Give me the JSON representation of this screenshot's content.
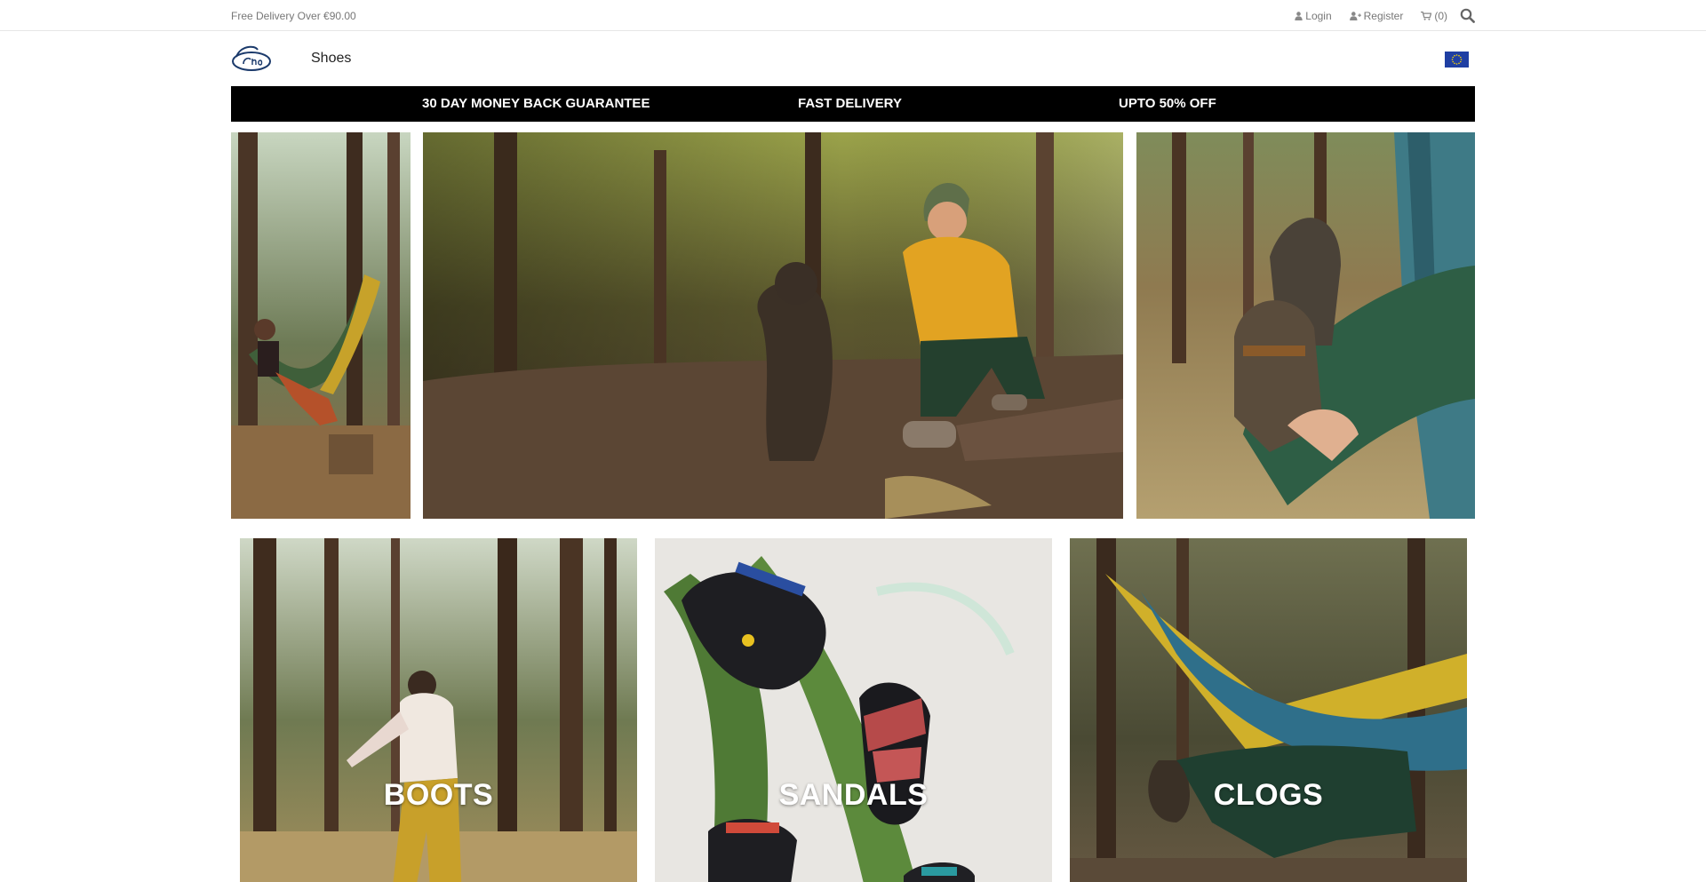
{
  "topbar": {
    "promo": "Free Delivery Over €90.00",
    "login_label": "Login",
    "register_label": "Register",
    "cart_label": "(0)"
  },
  "header": {
    "logo_alt": "Chaco",
    "nav_shoes": "Shoes",
    "region_flag": "eu-flag"
  },
  "usp_bar": {
    "guarantee": "30 DAY MONEY BACK GUARANTEE",
    "delivery": "FAST DELIVERY",
    "discount": "UPTO 50% OFF"
  },
  "categories": [
    {
      "label": "BOOTS"
    },
    {
      "label": "SANDALS"
    },
    {
      "label": "CLOGS"
    }
  ],
  "icons": {
    "user": "user-icon",
    "register": "user-plus-icon",
    "cart": "cart-icon",
    "search": "search-icon"
  },
  "colors": {
    "usp_bg": "#000000",
    "usp_text": "#ffffff",
    "muted_text": "#777777"
  }
}
